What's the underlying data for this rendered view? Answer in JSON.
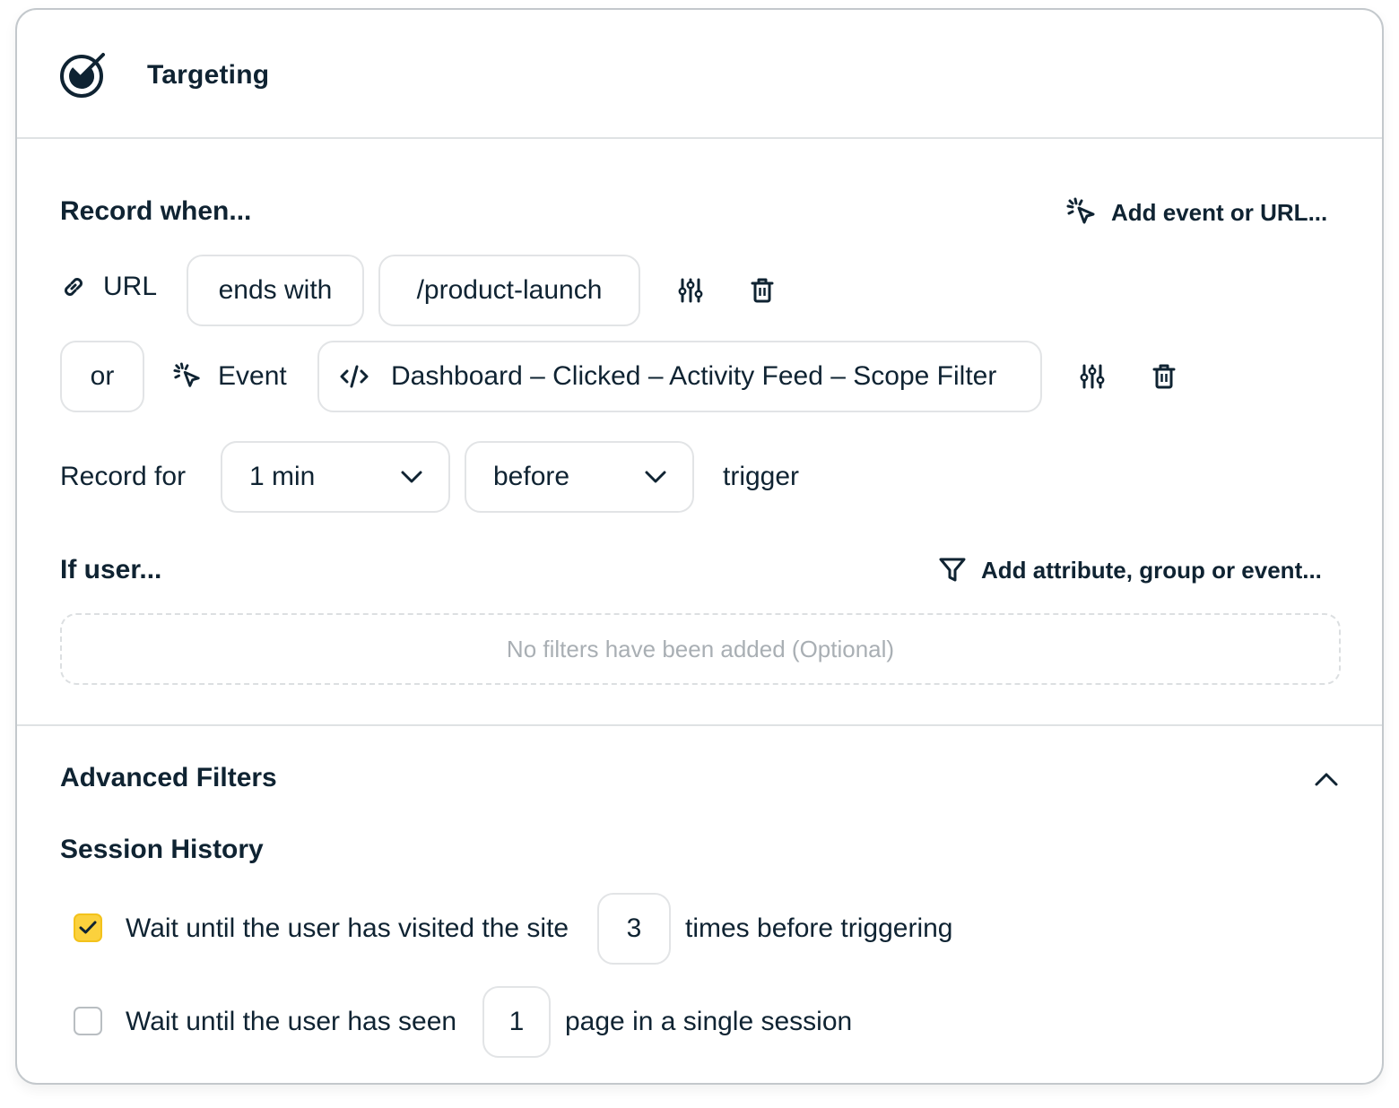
{
  "header": {
    "title": "Targeting",
    "icon": "target-icon"
  },
  "record_when": {
    "title": "Record when...",
    "add_button_label": "Add event or URL...",
    "add_button_icon": "click-cursor-icon",
    "conditions": [
      {
        "type_icon": "link-icon",
        "type_label": "URL",
        "operator": "ends with",
        "value": "/product-launch",
        "settings_icon": "sliders-icon",
        "delete_icon": "trash-icon"
      },
      {
        "connector": "or",
        "type_icon": "click-cursor-icon",
        "type_label": "Event",
        "value_icon": "code-icon",
        "value": "Dashboard – Clicked – Activity Feed – Scope Filter",
        "settings_icon": "sliders-icon",
        "delete_icon": "trash-icon"
      }
    ]
  },
  "record_for": {
    "label": "Record for",
    "duration": "1 min",
    "timing": "before",
    "suffix": "trigger"
  },
  "if_user": {
    "title": "If user...",
    "add_button_label": "Add attribute, group or event...",
    "add_button_icon": "filter-icon",
    "empty_text": "No filters have been added (Optional)"
  },
  "advanced_filters": {
    "title": "Advanced Filters",
    "expanded": true,
    "session_history": {
      "title": "Session History",
      "options": [
        {
          "checked": true,
          "prefix": "Wait until the user has visited the site",
          "value": "3",
          "suffix": "times before triggering"
        },
        {
          "checked": false,
          "prefix": "Wait until the user has seen",
          "value": "1",
          "suffix": "page in a single session"
        }
      ]
    }
  },
  "colors": {
    "text": "#0f2332",
    "border": "#e2e4e6",
    "checkbox_checked": "#fbd13d",
    "muted_text": "#a9afb4"
  }
}
